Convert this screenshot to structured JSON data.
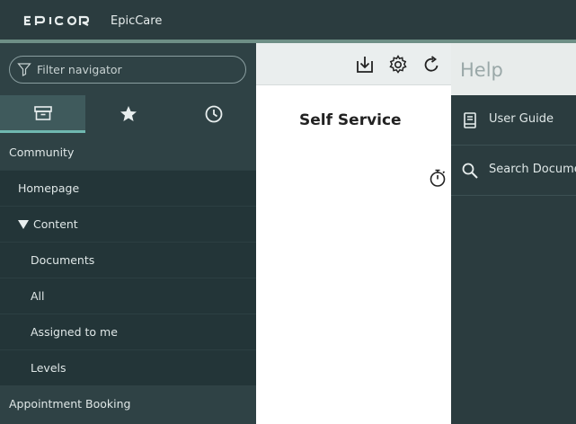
{
  "header": {
    "brand": "EPICOR",
    "app_title": "EpicCare"
  },
  "navigator": {
    "filter_placeholder": "Filter navigator",
    "tabs": [
      {
        "icon": "archive-icon",
        "active": true
      },
      {
        "icon": "star-icon",
        "active": false
      },
      {
        "icon": "clock-icon",
        "active": false
      }
    ],
    "items": [
      {
        "label": "Community",
        "level": 0
      },
      {
        "label": "Homepage",
        "level": 1
      },
      {
        "label": "Content",
        "level": 1,
        "expanded": true
      },
      {
        "label": "Documents",
        "level": 2
      },
      {
        "label": "All",
        "level": 2
      },
      {
        "label": "Assigned to me",
        "level": 2
      },
      {
        "label": "Levels",
        "level": 2
      },
      {
        "label": "Appointment Booking",
        "level": 0
      }
    ]
  },
  "toolbar": {
    "icons": [
      "download-icon",
      "gear-icon",
      "refresh-icon"
    ]
  },
  "main": {
    "title": "Self Service",
    "icon": "stopwatch-icon"
  },
  "help": {
    "title": "Help",
    "items": [
      {
        "label": "User Guide",
        "icon": "book-icon"
      },
      {
        "label": "Search Documents",
        "icon": "search-icon"
      }
    ]
  },
  "colors": {
    "topbar": "#2b3c3f",
    "navigator": "#2f4245",
    "sub_item": "#233538",
    "accent": "#6fb8b0"
  }
}
